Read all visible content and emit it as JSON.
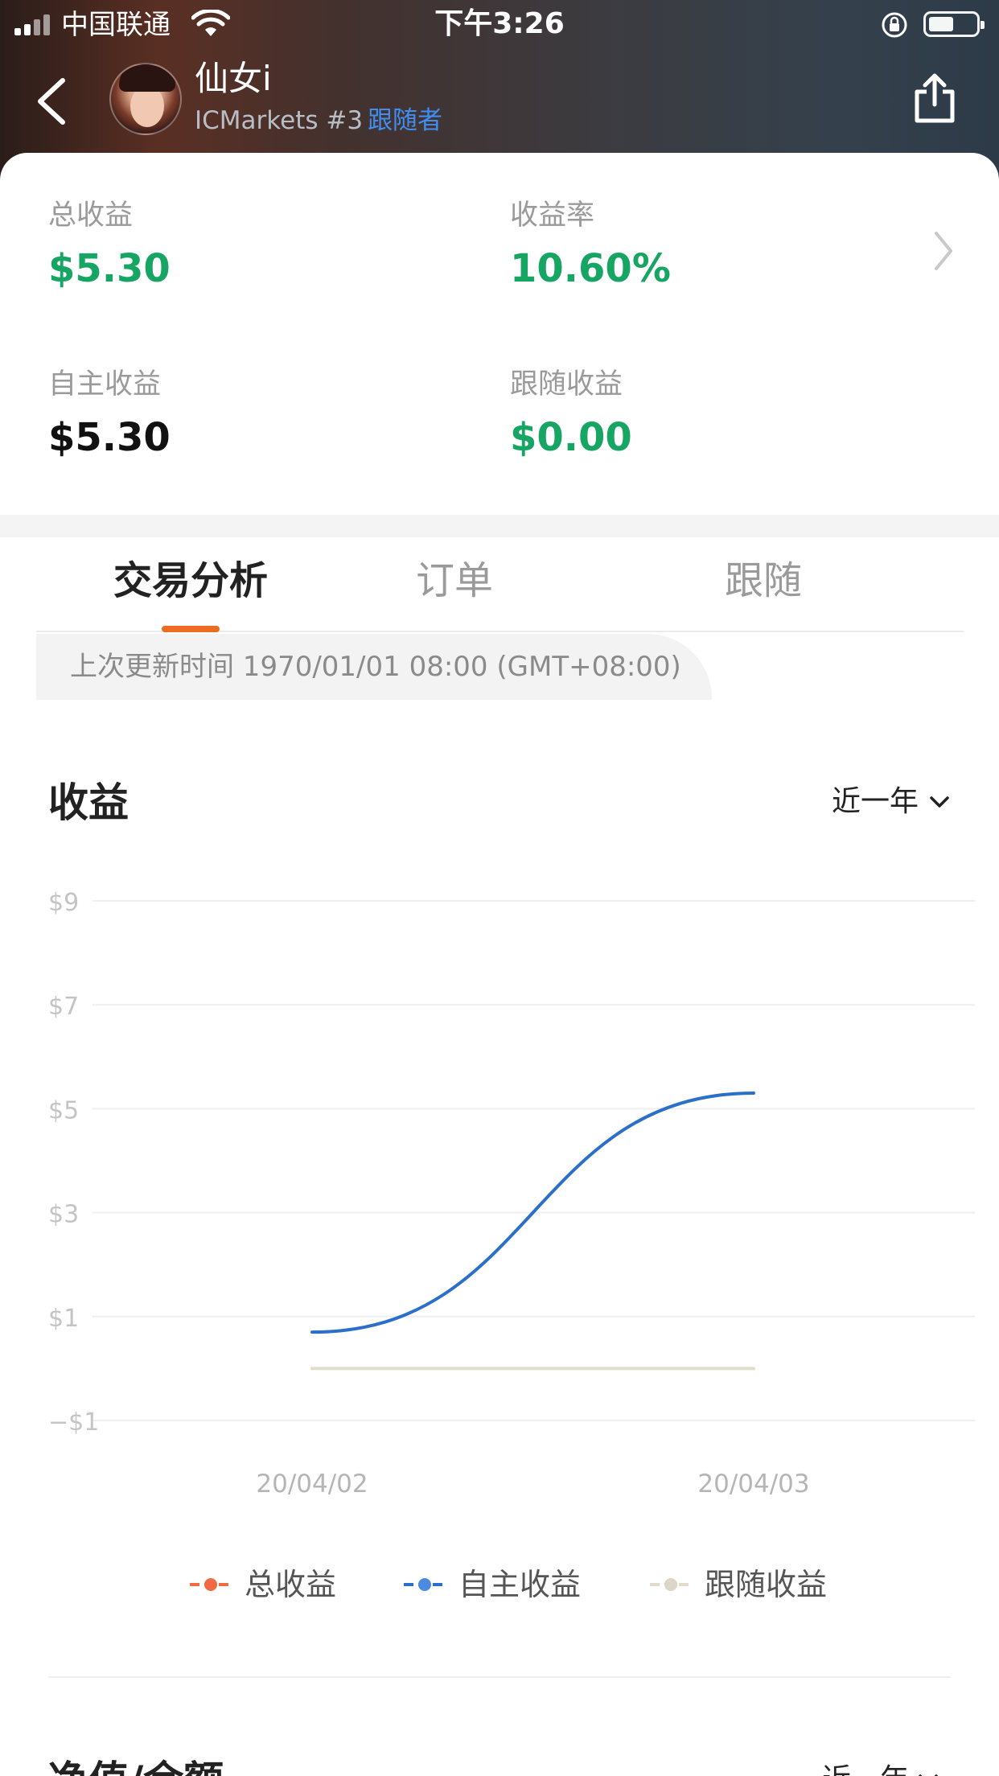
{
  "status_bar": {
    "carrier": "中国联通",
    "time": "下午3:26"
  },
  "header": {
    "name": "仙女i",
    "broker": "ICMarkets #3",
    "role": "跟随者"
  },
  "summary": {
    "total_label": "总收益",
    "total_value": "$5.30",
    "rate_label": "收益率",
    "rate_value": "10.60%",
    "self_label": "自主收益",
    "self_value": "$5.30",
    "follow_label": "跟随收益",
    "follow_value": "$0.00"
  },
  "tabs": [
    {
      "label": "交易分析",
      "active": true
    },
    {
      "label": "订单",
      "active": false
    },
    {
      "label": "跟随",
      "active": false
    }
  ],
  "update_text": "上次更新时间 1970/01/01 08:00 (GMT+08:00)",
  "profit_section": {
    "title": "收益",
    "range": "近一年"
  },
  "net_section": {
    "title": "净值/余额",
    "range": "近一年"
  },
  "colors": {
    "accent": "#ee6b22",
    "positive": "#17a563",
    "link": "#3f8ef2",
    "series_total": "#ee6b44",
    "series_self": "#2a6fc9",
    "series_follow": "#e3dccb"
  },
  "chart_data": {
    "type": "line",
    "x": [
      "20/04/02",
      "20/04/03"
    ],
    "yticks": [
      "$9",
      "$7",
      "$5",
      "$3",
      "$1",
      "−$1"
    ],
    "ytick_values": [
      9,
      7,
      5,
      3,
      1,
      -1
    ],
    "ylim": [
      -1,
      9
    ],
    "series": [
      {
        "name": "总收益",
        "values": [
          0,
          0
        ],
        "color": "#ee6b44",
        "visible": false
      },
      {
        "name": "自主收益",
        "values": [
          0.7,
          5.3
        ],
        "color": "#2a6fc9"
      },
      {
        "name": "跟随收益",
        "values": [
          0,
          0
        ],
        "color": "#e3dccb"
      }
    ],
    "grid": true,
    "legend": "bottom"
  }
}
